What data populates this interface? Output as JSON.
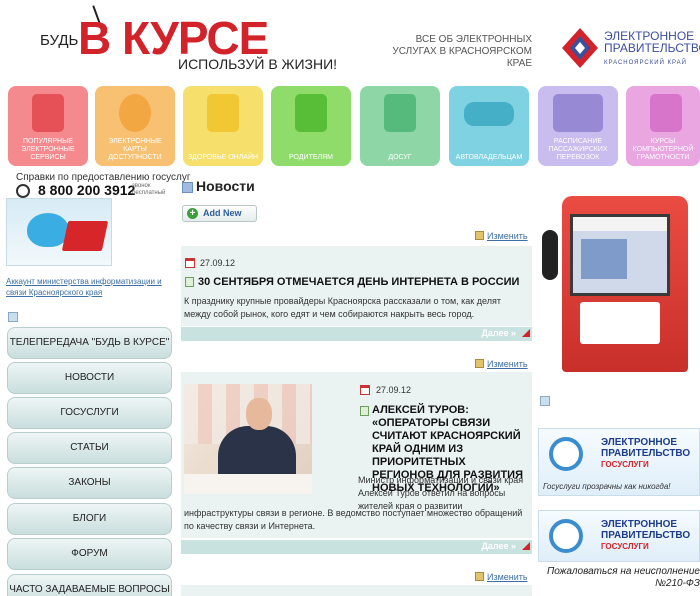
{
  "header": {
    "logo_part1": "БУДЬ",
    "logo_part2": "В КУРСЕ",
    "logo_part3": "ИСПОЛЬЗУЙ В ЖИЗНИ!",
    "tagline": "ВСЕ ОБ ЭЛЕКТРОННЫХ УСЛУГАХ В КРАСНОЯРСКОМ КРАЕ",
    "egov_title": "ЭЛЕКТРОННОЕ ПРАВИТЕЛЬСТВО",
    "egov_sub": "КРАСНОЯРСКИЙ КРАЙ"
  },
  "tiles": [
    {
      "label": "ПОПУЛЯРНЫЕ ЭЛЕКТРОННЫЕ СЕРВИСЫ",
      "color": "#f06b70",
      "icon": "info-kiosk-icon"
    },
    {
      "label": "ЭЛЕКТРОННЫЕ КАРТЫ ДОСТУПНОСТИ",
      "color": "#f6b14b",
      "icon": "globe-icon"
    },
    {
      "label": "ЗДОРОВЬЕ ОНЛАЙН",
      "color": "#f2d23a",
      "icon": "medical-cross-icon"
    },
    {
      "label": "РОДИТЕЛЯМ",
      "color": "#71cf4a",
      "icon": "family-icon"
    },
    {
      "label": "ДОСУГ",
      "color": "#68c98a",
      "icon": "leisure-icon"
    },
    {
      "label": "АВТОВЛАДЕЛЬЦАМ",
      "color": "#54c3d6",
      "icon": "car-icon"
    },
    {
      "label": "РАСПИСАНИЕ ПАССАЖИРСКИХ ПЕРЕВОЗОК",
      "color": "#b9a8e6",
      "icon": "train-icon"
    },
    {
      "label": "КУРСЫ КОМПЬЮТЕРНОЙ ГРАМОТНОСТИ",
      "color": "#e48ad6",
      "icon": "keyboard-icon"
    }
  ],
  "left": {
    "help_text": "Справки по предоставлению госуслуг",
    "phone": "8 800 200 3912",
    "phone_note": "звонок бесплатный",
    "twitter_link": "Аккаунт министерства информатизации и связи Красноярского края",
    "menu": [
      "ТЕЛЕПЕРЕДАЧА \"БУДЬ В КУРСЕ\"",
      "НОВОСТИ",
      "ГОСУСЛУГИ",
      "СТАТЬИ",
      "ЗАКОНЫ",
      "БЛОГИ",
      "ФОРУМ",
      "ЧАСТО ЗАДАВАЕМЫЕ ВОПРОСЫ"
    ]
  },
  "news": {
    "heading": "Новости",
    "add_new": "Add New",
    "edit": "Изменить",
    "more": "Далее »",
    "items": [
      {
        "date": "27.09.12",
        "title": "30 СЕНТЯБРЯ ОТМЕЧАЕТСЯ ДЕНЬ ИНТЕРНЕТА В РОССИИ",
        "text": "К празднику крупные провайдеры Красноярска рассказали о том, как делят между собой рынок, кого едят и чем собираются накрыть весь город."
      },
      {
        "date": "27.09.12",
        "title": "АЛЕКСЕЙ ТУРОВ: «ОПЕРАТОРЫ СВЯЗИ СЧИТАЮТ КРАСНОЯРСКИЙ КРАЙ ОДНИМ ИЗ ПРИОРИТЕТНЫХ РЕГИОНОВ ДЛЯ РАЗВИТИЯ НОВЫХ ТЕХНОЛОГИЙ»",
        "text_right": "Министр информатизации и связи края Алексей Туров ответил на вопросы жителей края о развитии",
        "text_full": "инфраструктуры связи в регионе. В ведомство поступает множество обращений по качеству связи и Интернета."
      }
    ]
  },
  "right": {
    "banner_title": "ЭЛЕКТРОННОЕ ПРАВИТЕЛЬСТВО",
    "banner_sub": "ГОСУСЛУГИ",
    "banner_slogan": "Госуслуги прозрачны как никогда!",
    "complain": "Пожаловаться на неисполнение №210-ФЗ"
  }
}
